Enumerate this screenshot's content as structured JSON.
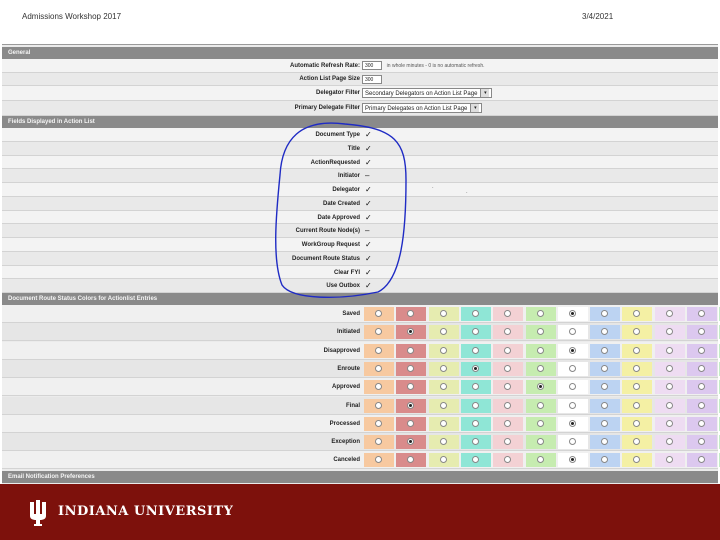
{
  "header": {
    "left": "Admissions Workshop 2017",
    "right": "3/4/2021"
  },
  "sections": {
    "general": "General",
    "fields": "Fields Displayed in Action List",
    "colors": "Document Route Status Colors for Actionlist Entries",
    "email": "Email Notification Preferences"
  },
  "general_rows": [
    {
      "label": "Automatic Refresh Rate:",
      "value": "300",
      "hint": "in whole minutes - 0 is no automatic refresh."
    },
    {
      "label": "Action List Page Size",
      "value": "300"
    },
    {
      "label": "Delegator Filter",
      "value": "Secondary Delegators on Action List Page"
    },
    {
      "label": "Primary Delegate Filter",
      "value": "Primary Delegates on Action List Page"
    }
  ],
  "field_rows": [
    {
      "label": "Document Type",
      "checked": true
    },
    {
      "label": "Title",
      "checked": true
    },
    {
      "label": "ActionRequested",
      "checked": true
    },
    {
      "label": "Initiator",
      "checked": false
    },
    {
      "label": "Delegator",
      "checked": true
    },
    {
      "label": "Date Created",
      "checked": true
    },
    {
      "label": "Date Approved",
      "checked": true
    },
    {
      "label": "Current Route Node(s)",
      "checked": false
    },
    {
      "label": "WorkGroup Request",
      "checked": true
    },
    {
      "label": "Document Route Status",
      "checked": true
    },
    {
      "label": "Clear FYI",
      "checked": true
    },
    {
      "label": "Use Outbox",
      "checked": true
    }
  ],
  "swatch_colors": [
    "#f7c9a0",
    "#d98b8b",
    "#e6ecb0",
    "#8fe6d6",
    "#f3d1d4",
    "#c6ecb0",
    "#ffffff",
    "#bcd3f2",
    "#f4f0a4",
    "#eedcf2",
    "#dcc8ef",
    "#c4ecc8"
  ],
  "status_rows": [
    {
      "label": "Saved",
      "selected": 6
    },
    {
      "label": "Initiated",
      "selected": 1
    },
    {
      "label": "Disapproved",
      "selected": 6
    },
    {
      "label": "Enroute",
      "selected": 3
    },
    {
      "label": "Approved",
      "selected": 5
    },
    {
      "label": "Final",
      "selected": 1
    },
    {
      "label": "Processed",
      "selected": 6
    },
    {
      "label": "Exception",
      "selected": 1
    },
    {
      "label": "Canceled",
      "selected": 6
    }
  ],
  "footer": {
    "university": "INDIANA UNIVERSITY"
  },
  "accent_colors": {
    "footer": "#7d110c",
    "annotation": "#1f2bc4"
  }
}
